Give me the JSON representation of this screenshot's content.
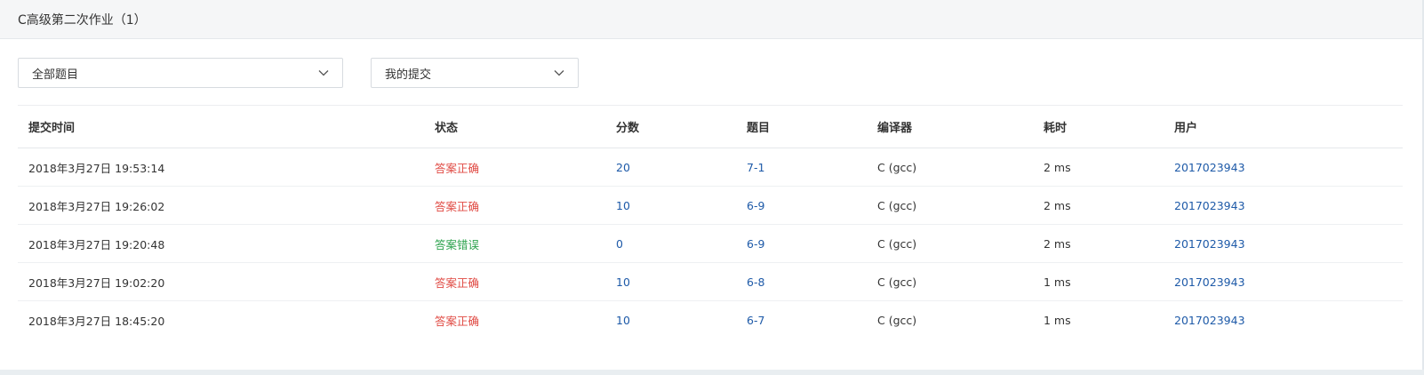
{
  "header": {
    "title": "C高级第二次作业（1）"
  },
  "filters": {
    "problem_select": "全部题目",
    "submission_select": "我的提交"
  },
  "table": {
    "columns": [
      "提交时间",
      "状态",
      "分数",
      "题目",
      "编译器",
      "耗时",
      "用户"
    ],
    "rows": [
      {
        "time": "2018年3月27日 19:53:14",
        "status": "答案正确",
        "status_type": "ok",
        "score": "20",
        "problem": "7-1",
        "compiler": "C (gcc)",
        "cost": "2 ms",
        "user": "2017023943"
      },
      {
        "time": "2018年3月27日 19:26:02",
        "status": "答案正确",
        "status_type": "ok",
        "score": "10",
        "problem": "6-9",
        "compiler": "C (gcc)",
        "cost": "2 ms",
        "user": "2017023943"
      },
      {
        "time": "2018年3月27日 19:20:48",
        "status": "答案错误",
        "status_type": "wrong",
        "score": "0",
        "problem": "6-9",
        "compiler": "C (gcc)",
        "cost": "2 ms",
        "user": "2017023943"
      },
      {
        "time": "2018年3月27日 19:02:20",
        "status": "答案正确",
        "status_type": "ok",
        "score": "10",
        "problem": "6-8",
        "compiler": "C (gcc)",
        "cost": "1 ms",
        "user": "2017023943"
      },
      {
        "time": "2018年3月27日 18:45:20",
        "status": "答案正确",
        "status_type": "ok",
        "score": "10",
        "problem": "6-7",
        "compiler": "C (gcc)",
        "cost": "1 ms",
        "user": "2017023943"
      }
    ]
  },
  "colors": {
    "accepted": "#e04a43",
    "wrong_answer": "#2ba24c",
    "link": "#1e5aa8"
  },
  "icons": {
    "select_arrow": "chevron-down-icon"
  }
}
